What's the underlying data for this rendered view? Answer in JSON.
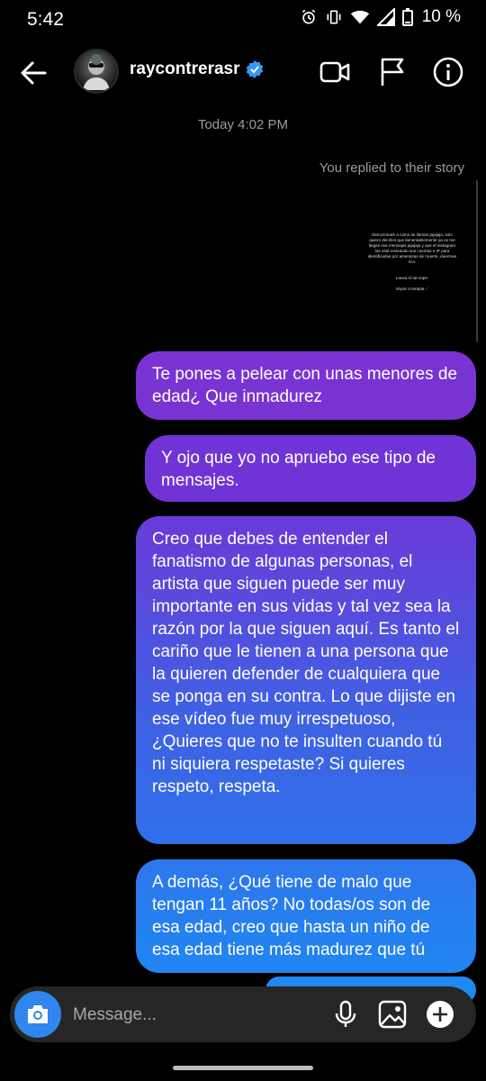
{
  "status": {
    "time": "5:42",
    "battery": "10 %"
  },
  "header": {
    "username": "raycontrerasr"
  },
  "thread": {
    "timestamp": "Today 4:02 PM",
    "replied_label": "You replied to their story",
    "story_text_lines": "Direccionaré a como se llaman jajajaja, solo quiero decirles que lamentablemente ya no me llegan sus mensajes jajajaja y que el instagram los está revisando sus cuentas e IP para identificarlas por amenazas de muerte, duerman rico.",
    "story_text_2": "Lauxa ni tan tope.",
    "story_text_3": "Vayan a terapia ☄"
  },
  "messages": [
    {
      "text": "Te pones a pelear con unas menores de edad¿ Que inmadurez"
    },
    {
      "text": "Y ojo que yo no apruebo ese tipo de mensajes."
    },
    {
      "text": "Creo que debes de entender el fanatismo de algunas personas, el artista que siguen puede ser muy importante en sus vidas y tal vez sea la razón por la que siguen aquí.  Es tanto el cariño que le tienen a una persona que la quieren defender de cualquiera que se ponga en su contra. Lo que dijiste en ese vídeo fue muy irrespetuoso, ¿Quieres que no te insulten cuando tú ni siquiera respetaste? Si quieres respeto, respeta."
    },
    {
      "text": "A demás, ¿Qué tiene de malo que tengan 11 años? No todas/os son de esa edad, creo que hasta un niño de esa edad tiene más madurez que tú"
    }
  ],
  "composer": {
    "placeholder": "Message..."
  },
  "colors": {
    "accent": "#2f86ee",
    "verified": "#3897f0",
    "bubble_purple": "#7a33d3",
    "bubble_blue": "#1f88f3"
  }
}
